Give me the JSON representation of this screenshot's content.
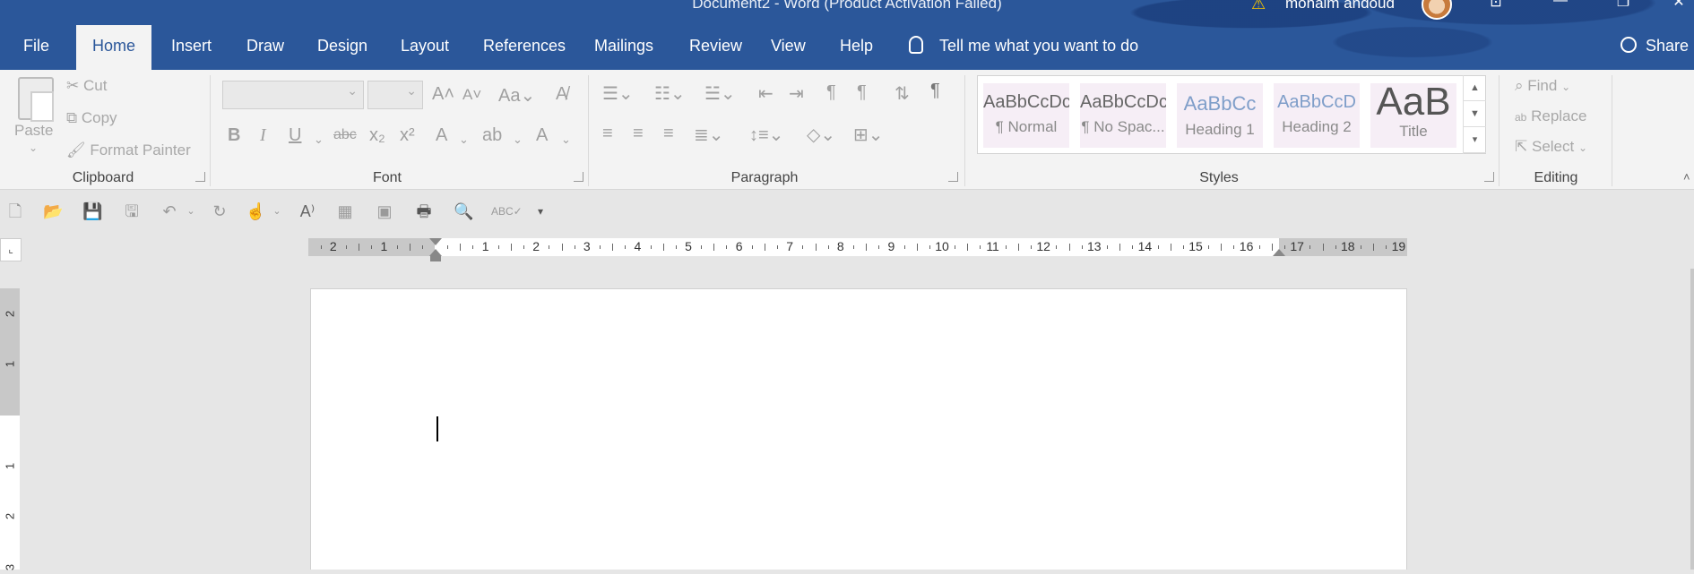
{
  "window": {
    "title": "Document2  -  Word (Product Activation Failed)",
    "user_name": "mohaim andoud"
  },
  "tabs": [
    {
      "label": "File"
    },
    {
      "label": "Home"
    },
    {
      "label": "Insert"
    },
    {
      "label": "Draw"
    },
    {
      "label": "Design"
    },
    {
      "label": "Layout"
    },
    {
      "label": "References"
    },
    {
      "label": "Mailings"
    },
    {
      "label": "Review"
    },
    {
      "label": "View"
    },
    {
      "label": "Help"
    }
  ],
  "active_tab": "Home",
  "tell_me": "Tell me what you want to do",
  "share": "Share",
  "clipboard": {
    "paste": "Paste",
    "cut": "Cut",
    "copy": "Copy",
    "format_painter": "Format Painter",
    "group": "Clipboard"
  },
  "font": {
    "group": "Font",
    "font_name": "",
    "font_size": ""
  },
  "paragraph": {
    "group": "Paragraph"
  },
  "styles": {
    "group": "Styles",
    "items": [
      {
        "sample": "AaBbCcDc",
        "name": "¶ Normal"
      },
      {
        "sample": "AaBbCcDc",
        "name": "¶ No Spac..."
      },
      {
        "sample": "AaBbCc",
        "name": "Heading 1"
      },
      {
        "sample": "AaBbCcD",
        "name": "Heading 2"
      },
      {
        "sample": "AaB",
        "name": "Title"
      }
    ]
  },
  "editing": {
    "group": "Editing",
    "find": "Find",
    "replace": "Replace",
    "select": "Select"
  },
  "ruler": {
    "h_left": [
      "2",
      "1"
    ],
    "h_right": [
      "1",
      "2",
      "3",
      "4",
      "5",
      "6",
      "7",
      "8",
      "9",
      "10",
      "11",
      "12",
      "13",
      "14",
      "15",
      "16",
      "17",
      "18",
      "19"
    ],
    "v_top": [
      "2",
      "1"
    ],
    "v_bottom": [
      "1",
      "2",
      "3"
    ]
  },
  "colors": {
    "accent": "#2b579a",
    "ribbon": "#f3f3f3",
    "canvas": "#e6e6e6"
  }
}
